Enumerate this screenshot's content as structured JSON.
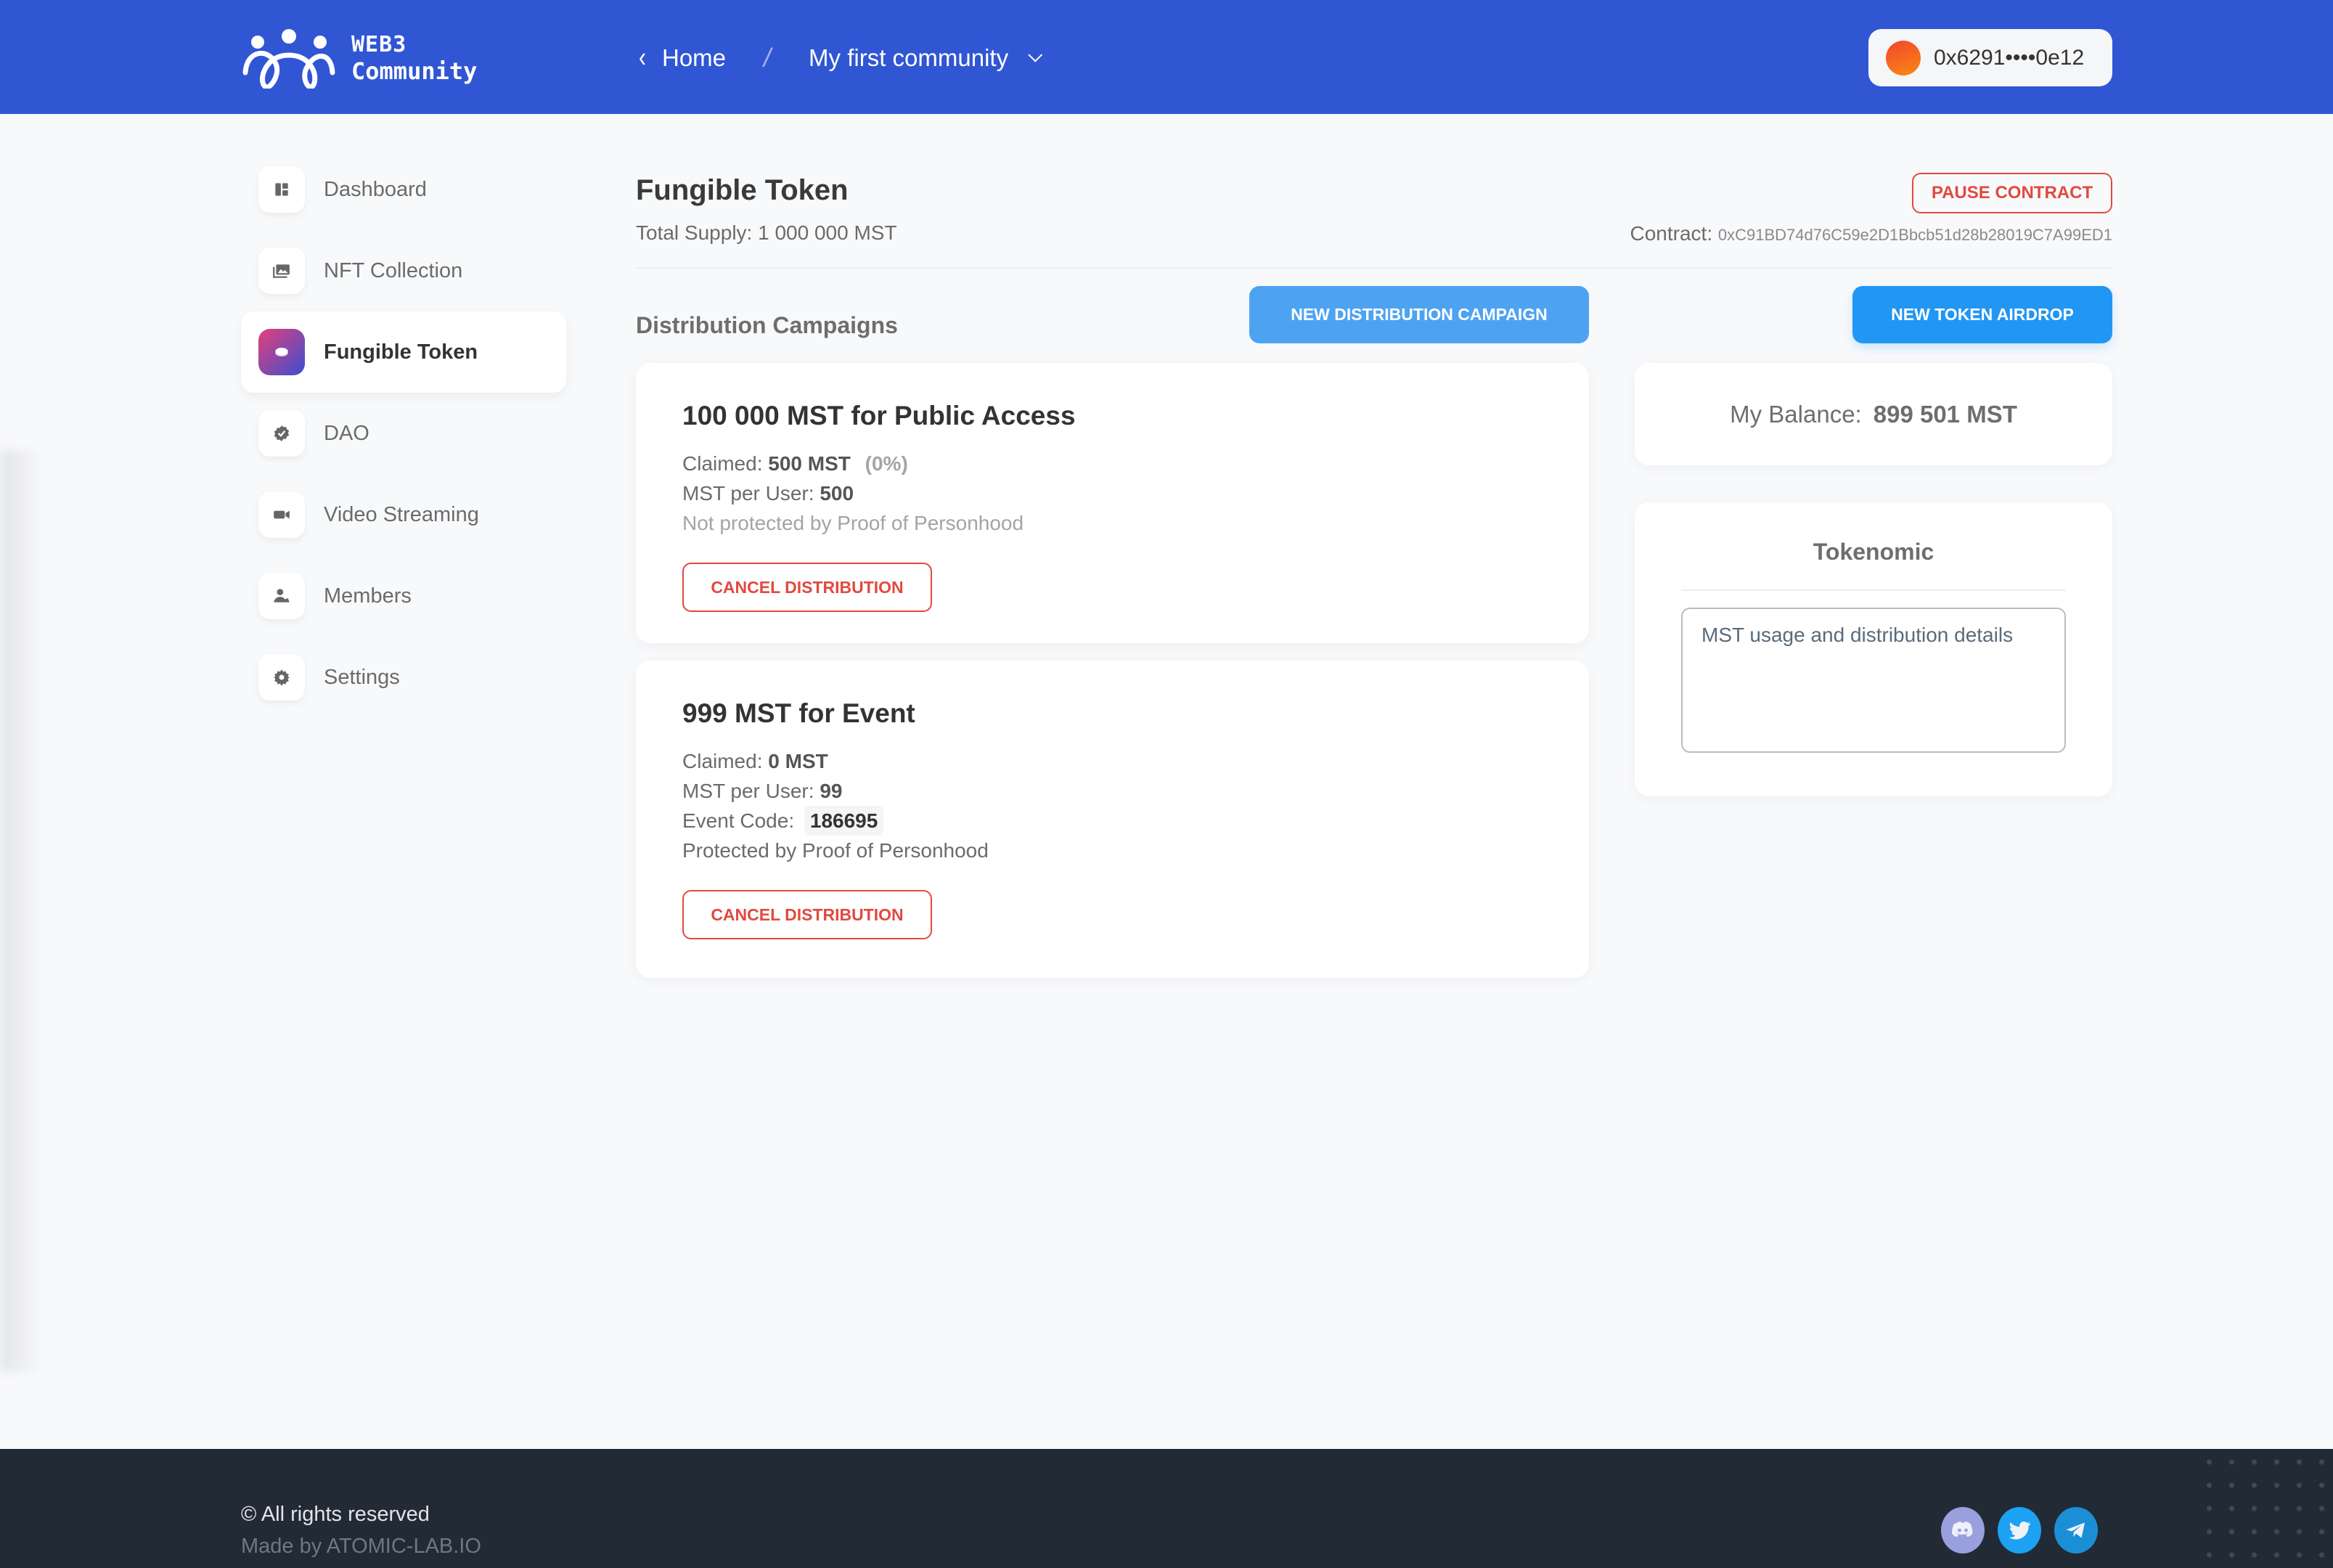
{
  "header": {
    "logo": {
      "line1": "WEB3",
      "line2": "Community",
      "icon": "people-logo-icon"
    },
    "breadcrumb": {
      "back_icon": "chevron-left-icon",
      "home": "Home",
      "separator": "/",
      "community": "My first community",
      "dropdown_icon": "chevron-down-icon"
    },
    "wallet": {
      "address": "0x6291••••0e12",
      "avatar_colors": [
        "#F2452E",
        "#F98A12"
      ]
    }
  },
  "sidebar": {
    "items": [
      {
        "label": "Dashboard",
        "icon": "dashboard-icon",
        "active": false
      },
      {
        "label": "NFT Collection",
        "icon": "image-collection-icon",
        "active": false
      },
      {
        "label": "Fungible Token",
        "icon": "coin-icon",
        "active": true
      },
      {
        "label": "DAO",
        "icon": "verified-badge-icon",
        "active": false
      },
      {
        "label": "Video Streaming",
        "icon": "video-camera-icon",
        "active": false
      },
      {
        "label": "Members",
        "icon": "members-icon",
        "active": false
      },
      {
        "label": "Settings",
        "icon": "gear-icon",
        "active": false
      }
    ]
  },
  "main": {
    "title": "Fungible Token",
    "total_supply": "Total Supply: 1 000 000 MST",
    "pause_button": "PAUSE CONTRACT",
    "contract_label": "Contract:",
    "contract_address": "0xC91BD74d76C59e2D1Bbcb51d28b28019C7A99ED1",
    "section_title": "Distribution Campaigns",
    "new_distribution_button": "NEW DISTRIBUTION CAMPAIGN",
    "new_airdrop_button": "NEW TOKEN AIRDROP",
    "campaigns": [
      {
        "title": "100 000 MST for Public Access",
        "claimed_label": "Claimed:",
        "claimed_value": "500 MST",
        "claimed_percent": "(0%)",
        "per_user_label": "MST per User:",
        "per_user_value": "500",
        "protection": "Not protected by Proof of Personhood",
        "cancel_button": "CANCEL DISTRIBUTION"
      },
      {
        "title": "999 MST for Event",
        "claimed_label": "Claimed:",
        "claimed_value": "0 MST",
        "per_user_label": "MST per User:",
        "per_user_value": "99",
        "event_code_label": "Event Code:",
        "event_code": "186695",
        "protection": "Protected by Proof of Personhood",
        "cancel_button": "CANCEL DISTRIBUTION"
      }
    ],
    "balance": {
      "label": "My Balance:",
      "value": "899 501 MST"
    },
    "tokenomic": {
      "title": "Tokenomic",
      "text": "MST usage and distribution details"
    }
  },
  "footer": {
    "rights": "© All rights reserved",
    "made_by": "Made by ATOMIC-LAB.IO",
    "socials": [
      {
        "name": "Discord",
        "icon": "discord-icon",
        "color": "#9A9FDE"
      },
      {
        "name": "Twitter",
        "icon": "twitter-icon",
        "color": "#1DA1F2"
      },
      {
        "name": "Telegram",
        "icon": "telegram-icon",
        "color": "#1B8FD6"
      }
    ]
  },
  "colors": {
    "header_bg": "#3056D3",
    "primary_button": "#4DA3F2",
    "airdrop_button": "#2196F3",
    "danger": "#E04A3F",
    "footer_bg": "#222A35"
  }
}
